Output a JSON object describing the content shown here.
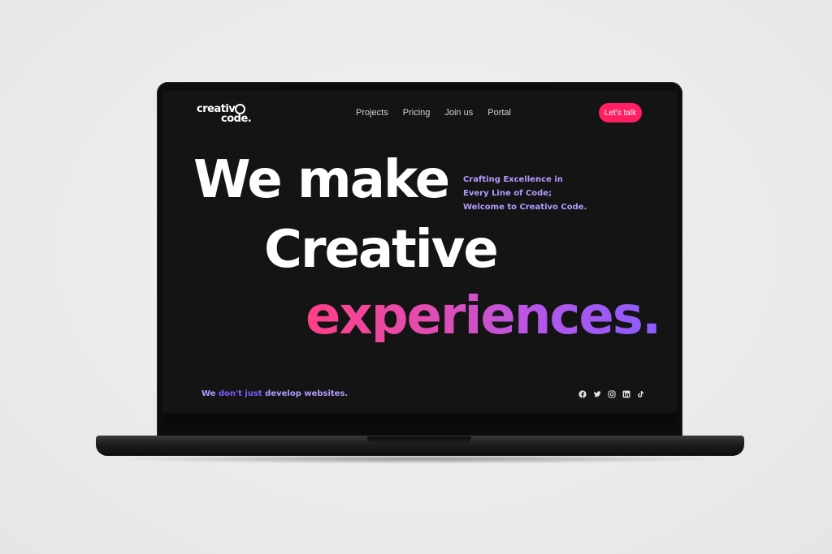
{
  "brand": {
    "line1": "creativ",
    "line2": "code."
  },
  "nav": {
    "items": [
      {
        "label": "Projects"
      },
      {
        "label": "Pricing"
      },
      {
        "label": "Join us"
      },
      {
        "label": "Portal"
      }
    ],
    "cta_label": "Let's talk"
  },
  "hero": {
    "line1": "We make",
    "line2": "Creative",
    "line3": "experiences."
  },
  "tagline": {
    "line1": "Crafting Excellence in",
    "line2": "Every Line of Code;",
    "line3": "Welcome to Creativo Code."
  },
  "subline": {
    "part1": "We ",
    "part2": "don't just",
    "part3": " develop websites."
  },
  "socials": [
    "facebook-icon",
    "twitter-icon",
    "instagram-icon",
    "linkedin-icon",
    "tiktok-icon"
  ],
  "colors": {
    "accent": "#ff1f62",
    "purple": "#b49bff",
    "gradient_start": "#ff3f86",
    "gradient_end": "#8a5cff",
    "screen_bg": "#141414"
  }
}
